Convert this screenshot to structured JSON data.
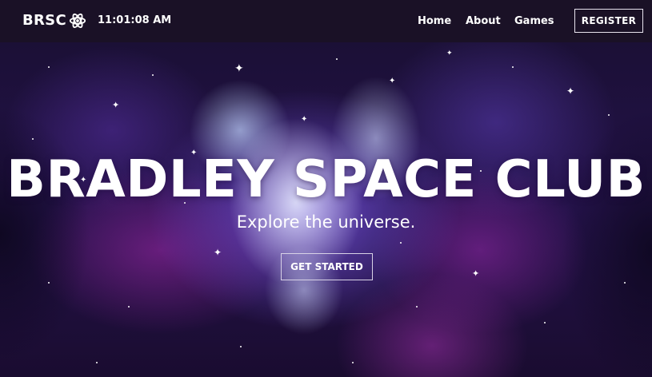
{
  "navbar": {
    "brand": "BRSC",
    "brand_icon": "atom-icon",
    "clock": "11:01:08 AM",
    "links": {
      "home": "Home",
      "about": "About",
      "games": "Games"
    },
    "register_label": "REGISTER"
  },
  "hero": {
    "title": "BRADLEY SPACE CLUB",
    "subtitle": "Explore the universe.",
    "cta_label": "GET STARTED"
  },
  "colors": {
    "navbar_bg": "#1a1126",
    "nebula_purple": "#7452dc",
    "nebula_magenta": "#a028aa",
    "text": "#ffffff"
  }
}
